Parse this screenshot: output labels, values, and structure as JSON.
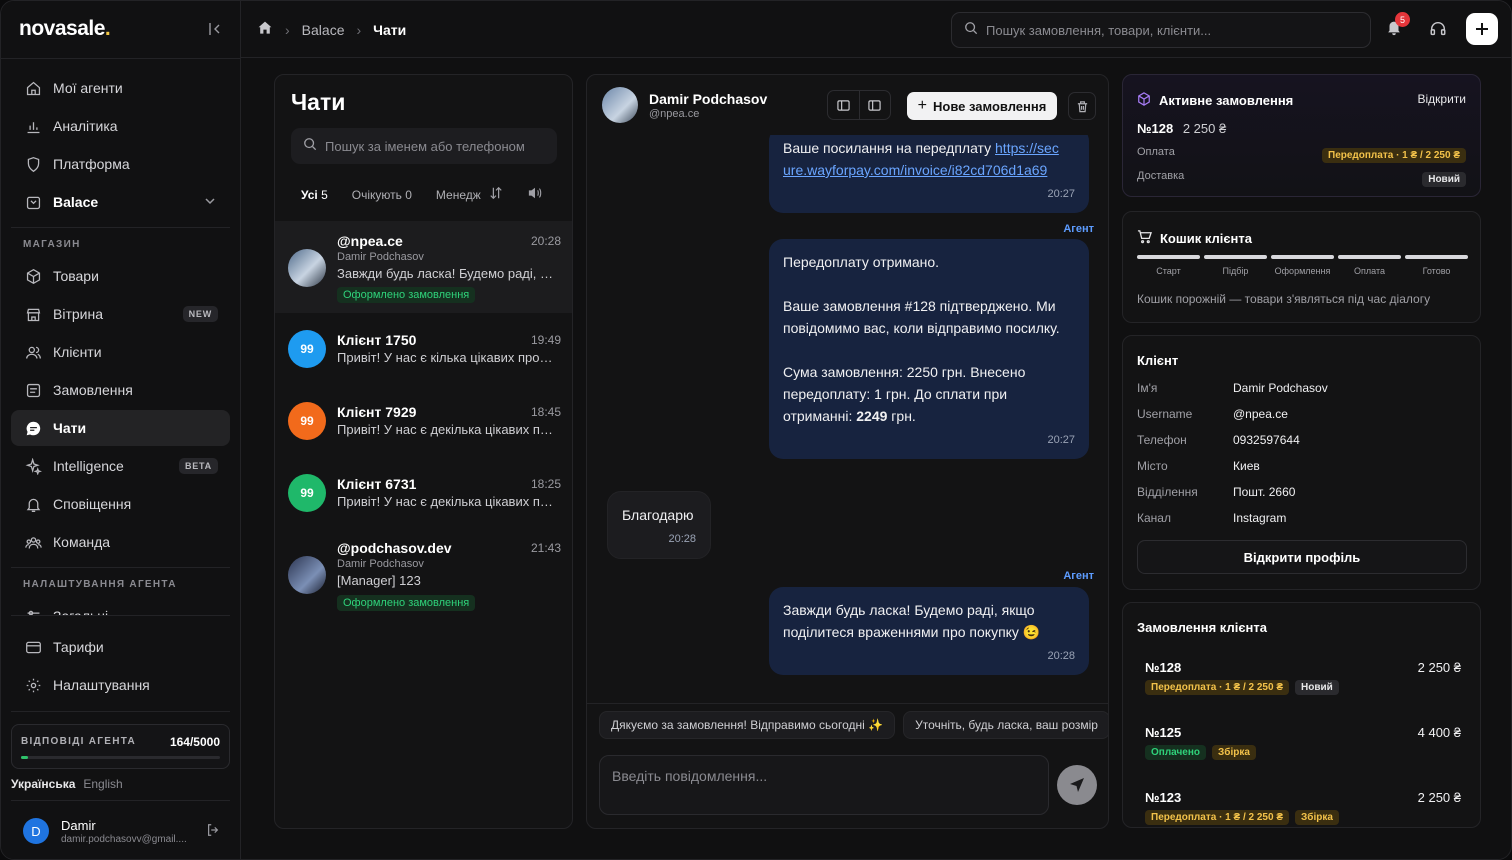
{
  "sidebar": {
    "logo": "novasale",
    "logo_dot": ".",
    "nav": [
      {
        "label": "Мої агенти",
        "icon": "home-icon"
      },
      {
        "label": "Аналітика",
        "icon": "chart-icon"
      },
      {
        "label": "Платформа",
        "icon": "shield-icon"
      },
      {
        "label": "Balace",
        "icon": "store-icon"
      }
    ],
    "section_shop": "МАГАЗИН",
    "shop": [
      {
        "label": "Товари",
        "icon": "box-icon"
      },
      {
        "label": "Вітрина",
        "icon": "storefront-icon",
        "badge": "NEW"
      },
      {
        "label": "Клієнти",
        "icon": "users-icon"
      },
      {
        "label": "Замовлення",
        "icon": "list-icon"
      },
      {
        "label": "Чати",
        "icon": "chat-icon"
      },
      {
        "label": "Intelligence",
        "icon": "sparkle-icon",
        "badge": "BETA"
      },
      {
        "label": "Сповіщення",
        "icon": "bell-icon"
      },
      {
        "label": "Команда",
        "icon": "team-icon"
      }
    ],
    "section_agent": "НАЛАШТУВАННЯ АГЕНТА",
    "agent_partial": "Загальні",
    "bottom": [
      {
        "label": "Тарифи",
        "icon": "card-icon"
      },
      {
        "label": "Налаштування",
        "icon": "gear-icon"
      }
    ],
    "usage": {
      "label": "ВІДПОВІДІ АГЕНТА",
      "value": "164/5000",
      "fraction": 0.033
    },
    "lang_active": "Українська",
    "lang_other": "English",
    "user": {
      "initial": "D",
      "name": "Damir",
      "email": "damir.podchasovv@gmail...."
    }
  },
  "topbar": {
    "crumb_store": "Balace",
    "crumb_current": "Чати",
    "search_placeholder": "Пошук замовлення, товари, клієнти...",
    "notifications": "5"
  },
  "chatlist": {
    "title": "Чати",
    "search_placeholder": "Пошук за іменем або телефоном",
    "filters": {
      "all": "Усі",
      "all_count": "5",
      "waiting": "Очікують",
      "waiting_count": "0",
      "manager": "Менедж"
    },
    "items": [
      {
        "name": "@npea.ce",
        "time": "20:28",
        "sub": "Damir Podchasov",
        "preview": "Завжди будь ласка! Будемо раді, якщо поділитеся враженнями",
        "tag": "Оформлено замовлення"
      },
      {
        "name": "Клієнт 1750",
        "time": "19:49",
        "preview": "Привіт! У нас є кілька цікавих пропозицій",
        "avatar": "99",
        "color": "#1e9bf0"
      },
      {
        "name": "Клієнт 7929",
        "time": "18:45",
        "preview": "Привіт! У нас є декілька цікавих пропозицій",
        "avatar": "99",
        "color": "#f26a1b"
      },
      {
        "name": "Клієнт 6731",
        "time": "18:25",
        "preview": "Привіт! У нас є декілька цікавих пропозицій",
        "avatar": "99",
        "color": "#1fb86a"
      },
      {
        "name": "@podchasov.dev",
        "time": "21:43",
        "sub": "Damir Podchasov",
        "preview": "[Manager] 123",
        "tag": "Оформлено замовлення"
      }
    ]
  },
  "chat": {
    "name": "Damir Podchasov",
    "handle": "@npea.ce",
    "new_order": "Нове замовлення",
    "msg1": {
      "text": "Ваше посилання на передплату ",
      "link": "https://secure.wayforpay.com/invoice/i82cd706d1a69",
      "link_l1": "https://sec",
      "link_l2": "ure.wayforpay.com/invoice/i82cd706d1a69",
      "time": "20:27"
    },
    "agent_label": "Агент",
    "msg2": {
      "p1": "Передоплату отримано.",
      "p2": "Ваше замовлення #128 підтверджено. Ми повідомимо вас, коли відправимо посилку.",
      "p3a": "Сума замовлення: 2250 грн. Внесено передоплату: 1 грн. До сплати при отриманні: ",
      "p3b": "2249",
      "p3c": " грн.",
      "time": "20:27"
    },
    "msg3": {
      "text": "Благодарю",
      "time": "20:28"
    },
    "msg4": {
      "text": "Завжди будь ласка! Будемо раді, якщо поділитеся враженнями про покупку 😉",
      "time": "20:28"
    },
    "quick1": "Дякуємо за замовлення! Відправимо сьогодні ✨",
    "quick2": "Уточніть, будь ласка, ваш розмір",
    "composer_placeholder": "Введіть повідомлення..."
  },
  "active_order": {
    "title": "Активне замовлення",
    "open": "Відкрити",
    "number": "№128",
    "amount": "2 250 ₴",
    "pay_label": "Оплата",
    "pay_value": "Передоплата · 1 ₴ / 2 250 ₴",
    "delivery_label": "Доставка",
    "delivery_value": "Новий"
  },
  "cart": {
    "title": "Кошик клієнта",
    "steps": [
      "Старт",
      "Підбір",
      "Оформлення",
      "Оплата",
      "Готово"
    ],
    "empty": "Кошик порожній — товари з'являться під час діалогу"
  },
  "client": {
    "title": "Клієнт",
    "rows": [
      {
        "k": "Ім'я",
        "v": "Damir Podchasov"
      },
      {
        "k": "Username",
        "v": "@npea.ce"
      },
      {
        "k": "Телефон",
        "v": "0932597644"
      },
      {
        "k": "Місто",
        "v": "Киев"
      },
      {
        "k": "Відділення",
        "v": "Пошт. 2660"
      },
      {
        "k": "Канал",
        "v": "Instagram"
      }
    ],
    "profile_btn": "Відкрити профіль"
  },
  "orders": {
    "title": "Замовлення клієнта",
    "items": [
      {
        "no": "№128",
        "sum": "2 250 ₴",
        "tag1": "Передоплата · 1 ₴ / 2 250 ₴",
        "tag2": "Новий"
      },
      {
        "no": "№125",
        "sum": "4 400 ₴",
        "tag1": "Оплачено",
        "tag2": "Збірка"
      },
      {
        "no": "№123",
        "sum": "2 250 ₴",
        "tag1": "Передоплата · 1 ₴ / 2 250 ₴",
        "tag2": "Збірка"
      }
    ]
  }
}
